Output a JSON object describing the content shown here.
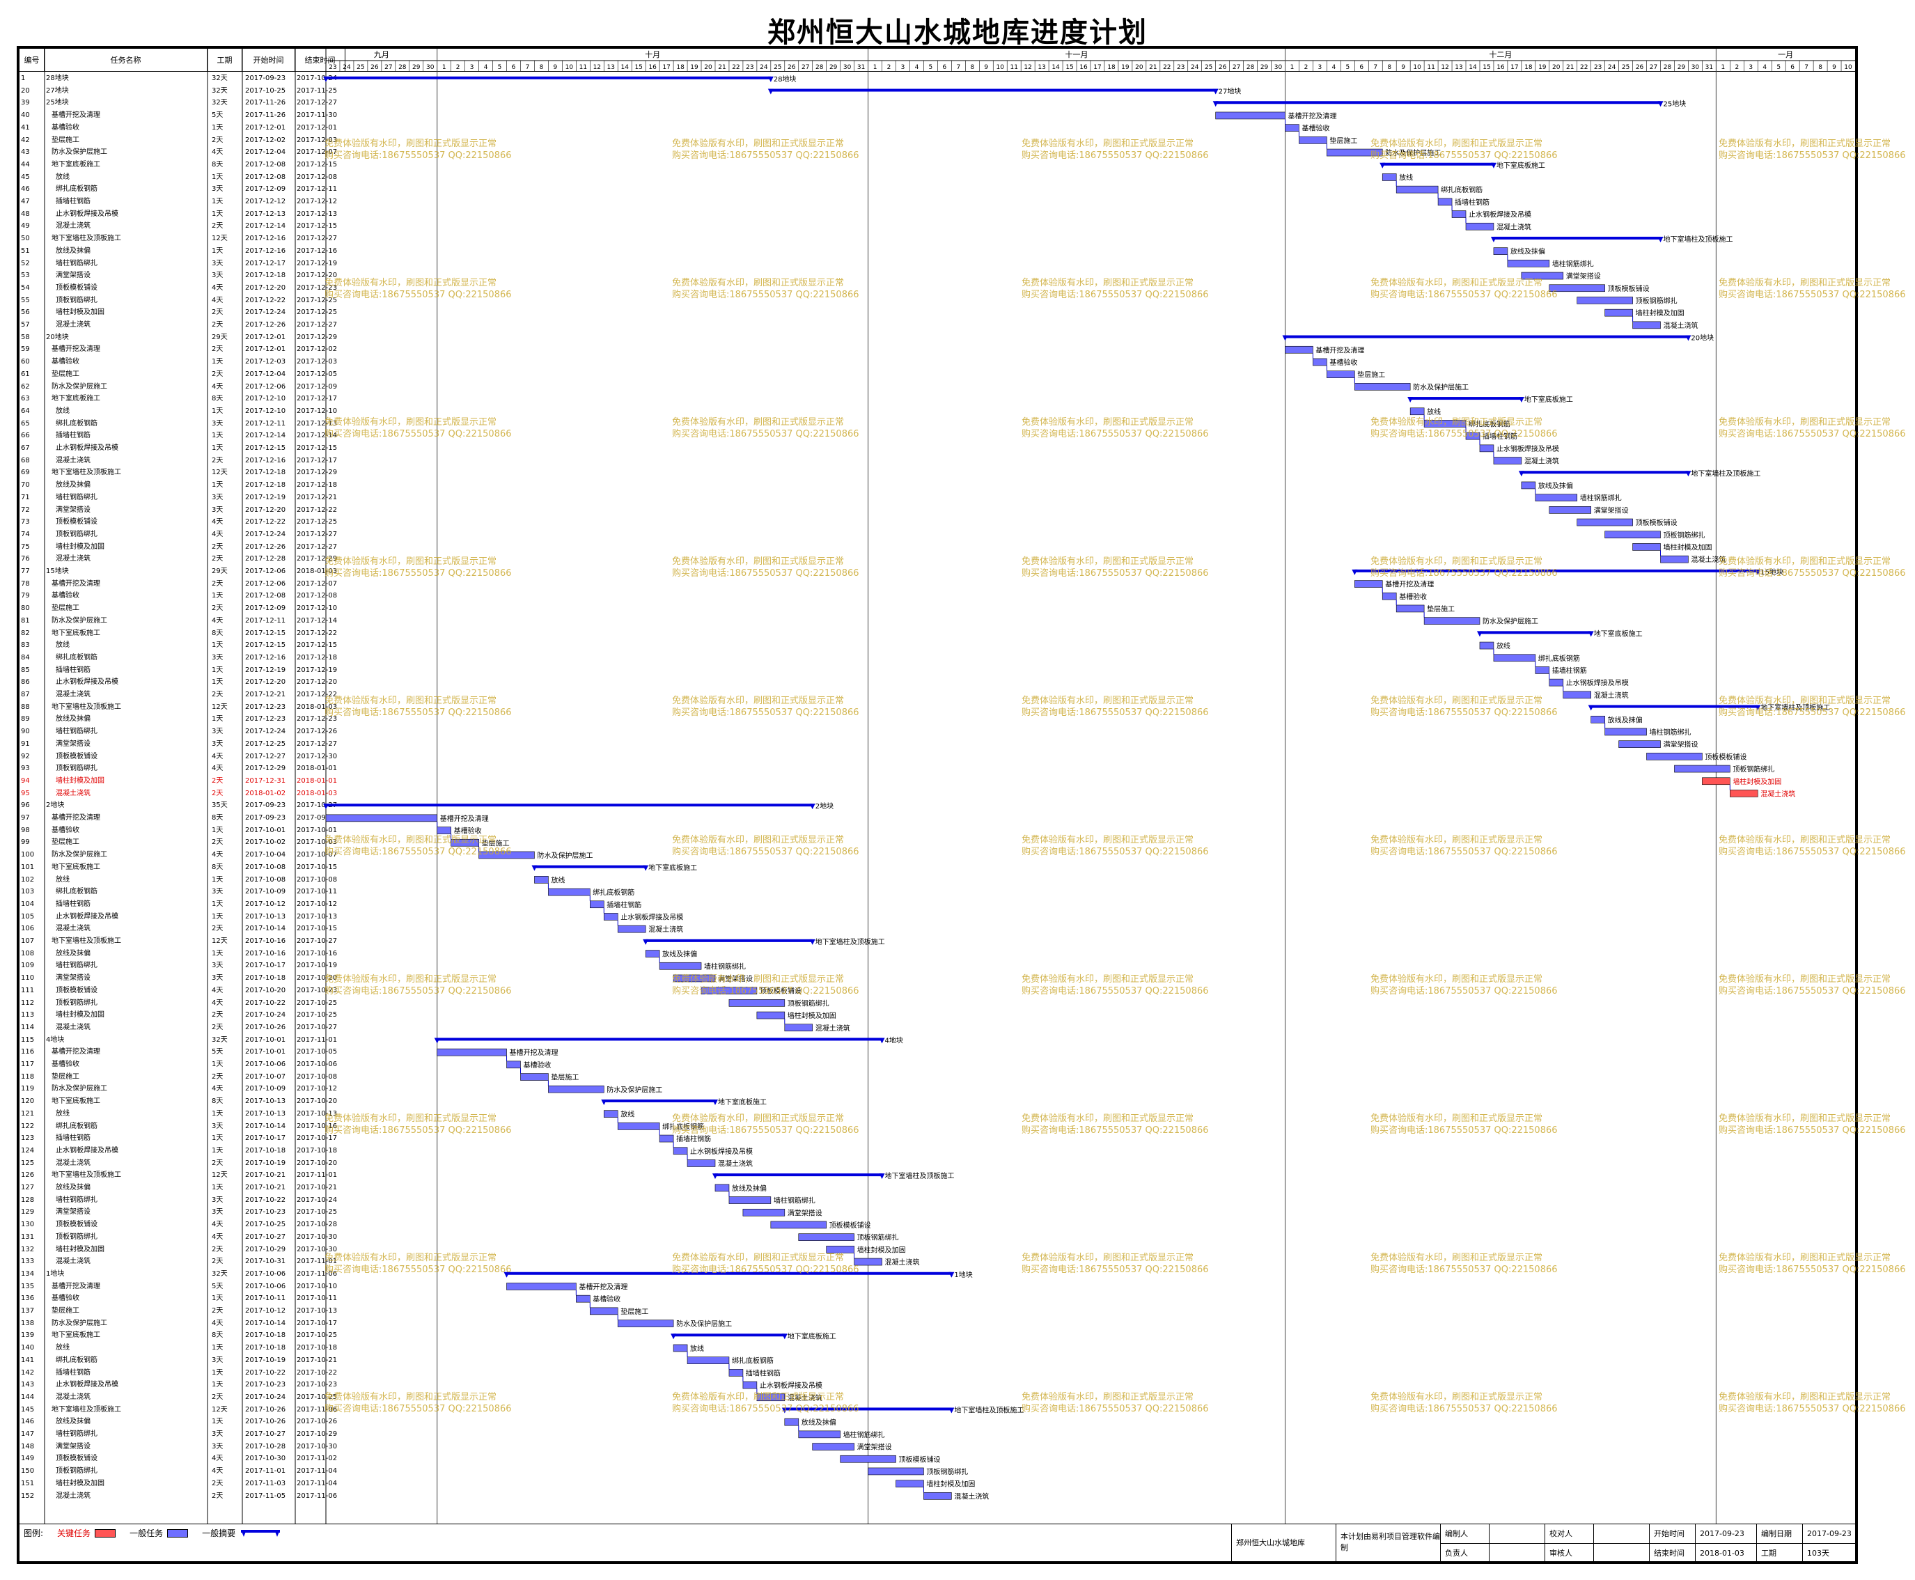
{
  "title": "郑州恒大山水城地库进度计划",
  "columns": {
    "id": "编号",
    "name": "任务名称",
    "duration": "工期",
    "start": "开始时间",
    "end": "结束时间"
  },
  "months": [
    "九月",
    "十月",
    "十一月",
    "十二月",
    "一月"
  ],
  "day_numbers": [
    "23",
    "24",
    "25",
    "26",
    "27",
    "28",
    "29",
    "30",
    "1",
    "2",
    "3",
    "4",
    "5",
    "6",
    "7",
    "8",
    "9",
    "10",
    "11",
    "12",
    "13",
    "14",
    "15",
    "16",
    "17",
    "18",
    "19",
    "20",
    "21",
    "22",
    "23",
    "24",
    "25",
    "26",
    "27",
    "28",
    "29",
    "30",
    "31",
    "1",
    "2",
    "3",
    "4",
    "5",
    "6",
    "7",
    "8",
    "9",
    "10",
    "11",
    "12",
    "13",
    "14",
    "15",
    "16",
    "17",
    "18",
    "19",
    "20",
    "21",
    "22",
    "23",
    "24",
    "25",
    "26",
    "27",
    "28",
    "29",
    "30",
    "1",
    "2",
    "3",
    "4",
    "5",
    "6",
    "7",
    "8",
    "9",
    "10",
    "11",
    "12",
    "13",
    "14",
    "15",
    "16",
    "17",
    "18",
    "19",
    "20",
    "21",
    "22",
    "23",
    "24",
    "25",
    "26",
    "27",
    "28",
    "29",
    "30",
    "31",
    "1",
    "2",
    "3",
    "4",
    "5",
    "6",
    "7",
    "8",
    "9",
    "10"
  ],
  "watermark": {
    "line1": "免费体验版有水印，刷图和正式版显示正常",
    "line2": "购买咨询电话:18675550537 QQ:22150866"
  },
  "tasks": [
    {
      "id": "1",
      "name": "28地块",
      "dur": "32天",
      "start": "2017-09-23",
      "end": "2017-10-24",
      "summary": true
    },
    {
      "id": "20",
      "name": "27地块",
      "dur": "32天",
      "start": "2017-10-25",
      "end": "2017-11-25",
      "summary": true
    },
    {
      "id": "39",
      "name": "25地块",
      "dur": "32天",
      "start": "2017-11-26",
      "end": "2017-12-27",
      "summary": true
    },
    {
      "id": "40",
      "name": "基槽开挖及清理",
      "dur": "5天",
      "start": "2017-11-26",
      "end": "2017-11-30",
      "sub": true
    },
    {
      "id": "41",
      "name": "基槽验收",
      "dur": "1天",
      "start": "2017-12-01",
      "end": "2017-12-01",
      "sub": true
    },
    {
      "id": "42",
      "name": "垫层施工",
      "dur": "2天",
      "start": "2017-12-02",
      "end": "2017-12-03",
      "sub": true
    },
    {
      "id": "43",
      "name": "防水及保护层施工",
      "dur": "4天",
      "start": "2017-12-04",
      "end": "2017-12-07",
      "sub": true
    },
    {
      "id": "44",
      "name": "地下室底板施工",
      "dur": "8天",
      "start": "2017-12-08",
      "end": "2017-12-15",
      "summary": true,
      "sub": true
    },
    {
      "id": "45",
      "name": "放线",
      "dur": "1天",
      "start": "2017-12-08",
      "end": "2017-12-08",
      "sub2": true
    },
    {
      "id": "46",
      "name": "绑扎底板钢筋",
      "dur": "3天",
      "start": "2017-12-09",
      "end": "2017-12-11",
      "sub2": true
    },
    {
      "id": "47",
      "name": "插墙柱钢筋",
      "dur": "1天",
      "start": "2017-12-12",
      "end": "2017-12-12",
      "sub2": true
    },
    {
      "id": "48",
      "name": "止水钢板焊接及吊模",
      "dur": "1天",
      "start": "2017-12-13",
      "end": "2017-12-13",
      "sub2": true
    },
    {
      "id": "49",
      "name": "混凝土浇筑",
      "dur": "2天",
      "start": "2017-12-14",
      "end": "2017-12-15",
      "sub2": true
    },
    {
      "id": "50",
      "name": "地下室墙柱及顶板施工",
      "dur": "12天",
      "start": "2017-12-16",
      "end": "2017-12-27",
      "summary": true,
      "sub": true
    },
    {
      "id": "51",
      "name": "放线及抹偏",
      "dur": "1天",
      "start": "2017-12-16",
      "end": "2017-12-16",
      "sub2": true
    },
    {
      "id": "52",
      "name": "墙柱钢筋绑扎",
      "dur": "3天",
      "start": "2017-12-17",
      "end": "2017-12-19",
      "sub2": true
    },
    {
      "id": "53",
      "name": "满堂架搭设",
      "dur": "3天",
      "start": "2017-12-18",
      "end": "2017-12-20",
      "sub2": true
    },
    {
      "id": "54",
      "name": "顶板模板铺设",
      "dur": "4天",
      "start": "2017-12-20",
      "end": "2017-12-23",
      "sub2": true
    },
    {
      "id": "55",
      "name": "顶板钢筋绑扎",
      "dur": "4天",
      "start": "2017-12-22",
      "end": "2017-12-25",
      "sub2": true
    },
    {
      "id": "56",
      "name": "墙柱封模及加固",
      "dur": "2天",
      "start": "2017-12-24",
      "end": "2017-12-25",
      "sub2": true
    },
    {
      "id": "57",
      "name": "混凝土浇筑",
      "dur": "2天",
      "start": "2017-12-26",
      "end": "2017-12-27",
      "sub2": true
    },
    {
      "id": "58",
      "name": "20地块",
      "dur": "29天",
      "start": "2017-12-01",
      "end": "2017-12-29",
      "summary": true
    },
    {
      "id": "59",
      "name": "基槽开挖及清理",
      "dur": "2天",
      "start": "2017-12-01",
      "end": "2017-12-02",
      "sub": true
    },
    {
      "id": "60",
      "name": "基槽验收",
      "dur": "1天",
      "start": "2017-12-03",
      "end": "2017-12-03",
      "sub": true
    },
    {
      "id": "61",
      "name": "垫层施工",
      "dur": "2天",
      "start": "2017-12-04",
      "end": "2017-12-05",
      "sub": true
    },
    {
      "id": "62",
      "name": "防水及保护层施工",
      "dur": "4天",
      "start": "2017-12-06",
      "end": "2017-12-09",
      "sub": true
    },
    {
      "id": "63",
      "name": "地下室底板施工",
      "dur": "8天",
      "start": "2017-12-10",
      "end": "2017-12-17",
      "summary": true,
      "sub": true
    },
    {
      "id": "64",
      "name": "放线",
      "dur": "1天",
      "start": "2017-12-10",
      "end": "2017-12-10",
      "sub2": true
    },
    {
      "id": "65",
      "name": "绑扎底板钢筋",
      "dur": "3天",
      "start": "2017-12-11",
      "end": "2017-12-13",
      "sub2": true
    },
    {
      "id": "66",
      "name": "插墙柱钢筋",
      "dur": "1天",
      "start": "2017-12-14",
      "end": "2017-12-14",
      "sub2": true
    },
    {
      "id": "67",
      "name": "止水钢板焊接及吊模",
      "dur": "1天",
      "start": "2017-12-15",
      "end": "2017-12-15",
      "sub2": true
    },
    {
      "id": "68",
      "name": "混凝土浇筑",
      "dur": "2天",
      "start": "2017-12-16",
      "end": "2017-12-17",
      "sub2": true
    },
    {
      "id": "69",
      "name": "地下室墙柱及顶板施工",
      "dur": "12天",
      "start": "2017-12-18",
      "end": "2017-12-29",
      "summary": true,
      "sub": true
    },
    {
      "id": "70",
      "name": "放线及抹偏",
      "dur": "1天",
      "start": "2017-12-18",
      "end": "2017-12-18",
      "sub2": true
    },
    {
      "id": "71",
      "name": "墙柱钢筋绑扎",
      "dur": "3天",
      "start": "2017-12-19",
      "end": "2017-12-21",
      "sub2": true
    },
    {
      "id": "72",
      "name": "满堂架搭设",
      "dur": "3天",
      "start": "2017-12-20",
      "end": "2017-12-22",
      "sub2": true
    },
    {
      "id": "73",
      "name": "顶板模板铺设",
      "dur": "4天",
      "start": "2017-12-22",
      "end": "2017-12-25",
      "sub2": true
    },
    {
      "id": "74",
      "name": "顶板钢筋绑扎",
      "dur": "4天",
      "start": "2017-12-24",
      "end": "2017-12-27",
      "sub2": true
    },
    {
      "id": "75",
      "name": "墙柱封模及加固",
      "dur": "2天",
      "start": "2017-12-26",
      "end": "2017-12-27",
      "sub2": true
    },
    {
      "id": "76",
      "name": "混凝土浇筑",
      "dur": "2天",
      "start": "2017-12-28",
      "end": "2017-12-29",
      "sub2": true
    },
    {
      "id": "77",
      "name": "15地块",
      "dur": "29天",
      "start": "2017-12-06",
      "end": "2018-01-03",
      "summary": true
    },
    {
      "id": "78",
      "name": "基槽开挖及清理",
      "dur": "2天",
      "start": "2017-12-06",
      "end": "2017-12-07",
      "sub": true
    },
    {
      "id": "79",
      "name": "基槽验收",
      "dur": "1天",
      "start": "2017-12-08",
      "end": "2017-12-08",
      "sub": true
    },
    {
      "id": "80",
      "name": "垫层施工",
      "dur": "2天",
      "start": "2017-12-09",
      "end": "2017-12-10",
      "sub": true
    },
    {
      "id": "81",
      "name": "防水及保护层施工",
      "dur": "4天",
      "start": "2017-12-11",
      "end": "2017-12-14",
      "sub": true
    },
    {
      "id": "82",
      "name": "地下室底板施工",
      "dur": "8天",
      "start": "2017-12-15",
      "end": "2017-12-22",
      "summary": true,
      "sub": true
    },
    {
      "id": "83",
      "name": "放线",
      "dur": "1天",
      "start": "2017-12-15",
      "end": "2017-12-15",
      "sub2": true
    },
    {
      "id": "84",
      "name": "绑扎底板钢筋",
      "dur": "3天",
      "start": "2017-12-16",
      "end": "2017-12-18",
      "sub2": true
    },
    {
      "id": "85",
      "name": "插墙柱钢筋",
      "dur": "1天",
      "start": "2017-12-19",
      "end": "2017-12-19",
      "sub2": true
    },
    {
      "id": "86",
      "name": "止水钢板焊接及吊模",
      "dur": "1天",
      "start": "2017-12-20",
      "end": "2017-12-20",
      "sub2": true
    },
    {
      "id": "87",
      "name": "混凝土浇筑",
      "dur": "2天",
      "start": "2017-12-21",
      "end": "2017-12-22",
      "sub2": true
    },
    {
      "id": "88",
      "name": "地下室墙柱及顶板施工",
      "dur": "12天",
      "start": "2017-12-23",
      "end": "2018-01-03",
      "summary": true,
      "sub": true
    },
    {
      "id": "89",
      "name": "放线及抹偏",
      "dur": "1天",
      "start": "2017-12-23",
      "end": "2017-12-23",
      "sub2": true
    },
    {
      "id": "90",
      "name": "墙柱钢筋绑扎",
      "dur": "3天",
      "start": "2017-12-24",
      "end": "2017-12-26",
      "sub2": true
    },
    {
      "id": "91",
      "name": "满堂架搭设",
      "dur": "3天",
      "start": "2017-12-25",
      "end": "2017-12-27",
      "sub2": true
    },
    {
      "id": "92",
      "name": "顶板模板铺设",
      "dur": "4天",
      "start": "2017-12-27",
      "end": "2017-12-30",
      "sub2": true
    },
    {
      "id": "93",
      "name": "顶板钢筋绑扎",
      "dur": "4天",
      "start": "2017-12-29",
      "end": "2018-01-01",
      "sub2": true
    },
    {
      "id": "94",
      "name": "墙柱封模及加固",
      "dur": "2天",
      "start": "2017-12-31",
      "end": "2018-01-01",
      "sub2": true,
      "critical": true
    },
    {
      "id": "95",
      "name": "混凝土浇筑",
      "dur": "2天",
      "start": "2018-01-02",
      "end": "2018-01-03",
      "sub2": true,
      "critical": true
    },
    {
      "id": "96",
      "name": "2地块",
      "dur": "35天",
      "start": "2017-09-23",
      "end": "2017-10-27",
      "summary": true
    },
    {
      "id": "97",
      "name": "基槽开挖及清理",
      "dur": "8天",
      "start": "2017-09-23",
      "end": "2017-09-30",
      "sub": true
    },
    {
      "id": "98",
      "name": "基槽验收",
      "dur": "1天",
      "start": "2017-10-01",
      "end": "2017-10-01",
      "sub": true
    },
    {
      "id": "99",
      "name": "垫层施工",
      "dur": "2天",
      "start": "2017-10-02",
      "end": "2017-10-03",
      "sub": true
    },
    {
      "id": "100",
      "name": "防水及保护层施工",
      "dur": "4天",
      "start": "2017-10-04",
      "end": "2017-10-07",
      "sub": true
    },
    {
      "id": "101",
      "name": "地下室底板施工",
      "dur": "8天",
      "start": "2017-10-08",
      "end": "2017-10-15",
      "summary": true,
      "sub": true
    },
    {
      "id": "102",
      "name": "放线",
      "dur": "1天",
      "start": "2017-10-08",
      "end": "2017-10-08",
      "sub2": true
    },
    {
      "id": "103",
      "name": "绑扎底板钢筋",
      "dur": "3天",
      "start": "2017-10-09",
      "end": "2017-10-11",
      "sub2": true
    },
    {
      "id": "104",
      "name": "插墙柱钢筋",
      "dur": "1天",
      "start": "2017-10-12",
      "end": "2017-10-12",
      "sub2": true
    },
    {
      "id": "105",
      "name": "止水钢板焊接及吊模",
      "dur": "1天",
      "start": "2017-10-13",
      "end": "2017-10-13",
      "sub2": true
    },
    {
      "id": "106",
      "name": "混凝土浇筑",
      "dur": "2天",
      "start": "2017-10-14",
      "end": "2017-10-15",
      "sub2": true
    },
    {
      "id": "107",
      "name": "地下室墙柱及顶板施工",
      "dur": "12天",
      "start": "2017-10-16",
      "end": "2017-10-27",
      "summary": true,
      "sub": true
    },
    {
      "id": "108",
      "name": "放线及抹偏",
      "dur": "1天",
      "start": "2017-10-16",
      "end": "2017-10-16",
      "sub2": true
    },
    {
      "id": "109",
      "name": "墙柱钢筋绑扎",
      "dur": "3天",
      "start": "2017-10-17",
      "end": "2017-10-19",
      "sub2": true
    },
    {
      "id": "110",
      "name": "满堂架搭设",
      "dur": "3天",
      "start": "2017-10-18",
      "end": "2017-10-20",
      "sub2": true
    },
    {
      "id": "111",
      "name": "顶板模板铺设",
      "dur": "4天",
      "start": "2017-10-20",
      "end": "2017-10-23",
      "sub2": true
    },
    {
      "id": "112",
      "name": "顶板钢筋绑扎",
      "dur": "4天",
      "start": "2017-10-22",
      "end": "2017-10-25",
      "sub2": true
    },
    {
      "id": "113",
      "name": "墙柱封模及加固",
      "dur": "2天",
      "start": "2017-10-24",
      "end": "2017-10-25",
      "sub2": true
    },
    {
      "id": "114",
      "name": "混凝土浇筑",
      "dur": "2天",
      "start": "2017-10-26",
      "end": "2017-10-27",
      "sub2": true
    },
    {
      "id": "115",
      "name": "4地块",
      "dur": "32天",
      "start": "2017-10-01",
      "end": "2017-11-01",
      "summary": true
    },
    {
      "id": "116",
      "name": "基槽开挖及清理",
      "dur": "5天",
      "start": "2017-10-01",
      "end": "2017-10-05",
      "sub": true
    },
    {
      "id": "117",
      "name": "基槽验收",
      "dur": "1天",
      "start": "2017-10-06",
      "end": "2017-10-06",
      "sub": true
    },
    {
      "id": "118",
      "name": "垫层施工",
      "dur": "2天",
      "start": "2017-10-07",
      "end": "2017-10-08",
      "sub": true
    },
    {
      "id": "119",
      "name": "防水及保护层施工",
      "dur": "4天",
      "start": "2017-10-09",
      "end": "2017-10-12",
      "sub": true
    },
    {
      "id": "120",
      "name": "地下室底板施工",
      "dur": "8天",
      "start": "2017-10-13",
      "end": "2017-10-20",
      "summary": true,
      "sub": true
    },
    {
      "id": "121",
      "name": "放线",
      "dur": "1天",
      "start": "2017-10-13",
      "end": "2017-10-13",
      "sub2": true
    },
    {
      "id": "122",
      "name": "绑扎底板钢筋",
      "dur": "3天",
      "start": "2017-10-14",
      "end": "2017-10-16",
      "sub2": true
    },
    {
      "id": "123",
      "name": "插墙柱钢筋",
      "dur": "1天",
      "start": "2017-10-17",
      "end": "2017-10-17",
      "sub2": true
    },
    {
      "id": "124",
      "name": "止水钢板焊接及吊模",
      "dur": "1天",
      "start": "2017-10-18",
      "end": "2017-10-18",
      "sub2": true
    },
    {
      "id": "125",
      "name": "混凝土浇筑",
      "dur": "2天",
      "start": "2017-10-19",
      "end": "2017-10-20",
      "sub2": true
    },
    {
      "id": "126",
      "name": "地下室墙柱及顶板施工",
      "dur": "12天",
      "start": "2017-10-21",
      "end": "2017-11-01",
      "summary": true,
      "sub": true
    },
    {
      "id": "127",
      "name": "放线及抹偏",
      "dur": "1天",
      "start": "2017-10-21",
      "end": "2017-10-21",
      "sub2": true
    },
    {
      "id": "128",
      "name": "墙柱钢筋绑扎",
      "dur": "3天",
      "start": "2017-10-22",
      "end": "2017-10-24",
      "sub2": true
    },
    {
      "id": "129",
      "name": "满堂架搭设",
      "dur": "3天",
      "start": "2017-10-23",
      "end": "2017-10-25",
      "sub2": true
    },
    {
      "id": "130",
      "name": "顶板模板铺设",
      "dur": "4天",
      "start": "2017-10-25",
      "end": "2017-10-28",
      "sub2": true
    },
    {
      "id": "131",
      "name": "顶板钢筋绑扎",
      "dur": "4天",
      "start": "2017-10-27",
      "end": "2017-10-30",
      "sub2": true
    },
    {
      "id": "132",
      "name": "墙柱封模及加固",
      "dur": "2天",
      "start": "2017-10-29",
      "end": "2017-10-30",
      "sub2": true
    },
    {
      "id": "133",
      "name": "混凝土浇筑",
      "dur": "2天",
      "start": "2017-10-31",
      "end": "2017-11-01",
      "sub2": true
    },
    {
      "id": "134",
      "name": "1地块",
      "dur": "32天",
      "start": "2017-10-06",
      "end": "2017-11-06",
      "summary": true
    },
    {
      "id": "135",
      "name": "基槽开挖及清理",
      "dur": "5天",
      "start": "2017-10-06",
      "end": "2017-10-10",
      "sub": true
    },
    {
      "id": "136",
      "name": "基槽验收",
      "dur": "1天",
      "start": "2017-10-11",
      "end": "2017-10-11",
      "sub": true
    },
    {
      "id": "137",
      "name": "垫层施工",
      "dur": "2天",
      "start": "2017-10-12",
      "end": "2017-10-13",
      "sub": true
    },
    {
      "id": "138",
      "name": "防水及保护层施工",
      "dur": "4天",
      "start": "2017-10-14",
      "end": "2017-10-17",
      "sub": true
    },
    {
      "id": "139",
      "name": "地下室底板施工",
      "dur": "8天",
      "start": "2017-10-18",
      "end": "2017-10-25",
      "summary": true,
      "sub": true
    },
    {
      "id": "140",
      "name": "放线",
      "dur": "1天",
      "start": "2017-10-18",
      "end": "2017-10-18",
      "sub2": true
    },
    {
      "id": "141",
      "name": "绑扎底板钢筋",
      "dur": "3天",
      "start": "2017-10-19",
      "end": "2017-10-21",
      "sub2": true
    },
    {
      "id": "142",
      "name": "插墙柱钢筋",
      "dur": "1天",
      "start": "2017-10-22",
      "end": "2017-10-22",
      "sub2": true
    },
    {
      "id": "143",
      "name": "止水钢板焊接及吊模",
      "dur": "1天",
      "start": "2017-10-23",
      "end": "2017-10-23",
      "sub2": true
    },
    {
      "id": "144",
      "name": "混凝土浇筑",
      "dur": "2天",
      "start": "2017-10-24",
      "end": "2017-10-25",
      "sub2": true
    },
    {
      "id": "145",
      "name": "地下室墙柱及顶板施工",
      "dur": "12天",
      "start": "2017-10-26",
      "end": "2017-11-06",
      "summary": true,
      "sub": true
    },
    {
      "id": "146",
      "name": "放线及抹偏",
      "dur": "1天",
      "start": "2017-10-26",
      "end": "2017-10-26",
      "sub2": true
    },
    {
      "id": "147",
      "name": "墙柱钢筋绑扎",
      "dur": "3天",
      "start": "2017-10-27",
      "end": "2017-10-29",
      "sub2": true
    },
    {
      "id": "148",
      "name": "满堂架搭设",
      "dur": "3天",
      "start": "2017-10-28",
      "end": "2017-10-30",
      "sub2": true
    },
    {
      "id": "149",
      "name": "顶板模板铺设",
      "dur": "4天",
      "start": "2017-10-30",
      "end": "2017-11-02",
      "sub2": true
    },
    {
      "id": "150",
      "name": "顶板钢筋绑扎",
      "dur": "4天",
      "start": "2017-11-01",
      "end": "2017-11-04",
      "sub2": true
    },
    {
      "id": "151",
      "name": "墙柱封模及加固",
      "dur": "2天",
      "start": "2017-11-03",
      "end": "2017-11-04",
      "sub2": true
    },
    {
      "id": "152",
      "name": "混凝土浇筑",
      "dur": "2天",
      "start": "2017-11-05",
      "end": "2017-11-06",
      "sub2": true
    }
  ],
  "legend": {
    "label": "图例:",
    "critical": "关键任务",
    "normal": "一般任务",
    "summary": "一般摘要"
  },
  "colors": {
    "critical": "#ff5555",
    "normal": "#6f6fff",
    "summary": "#0000dd",
    "critical_text": "#e00000"
  },
  "footer": {
    "project": "郑州恒大山水城地库",
    "software": "本计划由易利项目管理软件编制",
    "compiler_label": "编制人",
    "reviewer_label": "校对人",
    "owner_label": "负责人",
    "approver_label": "审核人",
    "start_label": "开始时间",
    "start_value": "2017-09-23",
    "end_label": "结束时间",
    "end_value": "2018-01-03",
    "date_label": "编制日期",
    "date_value": "2017-09-23",
    "dur_label": "工期",
    "dur_value": "103天"
  }
}
